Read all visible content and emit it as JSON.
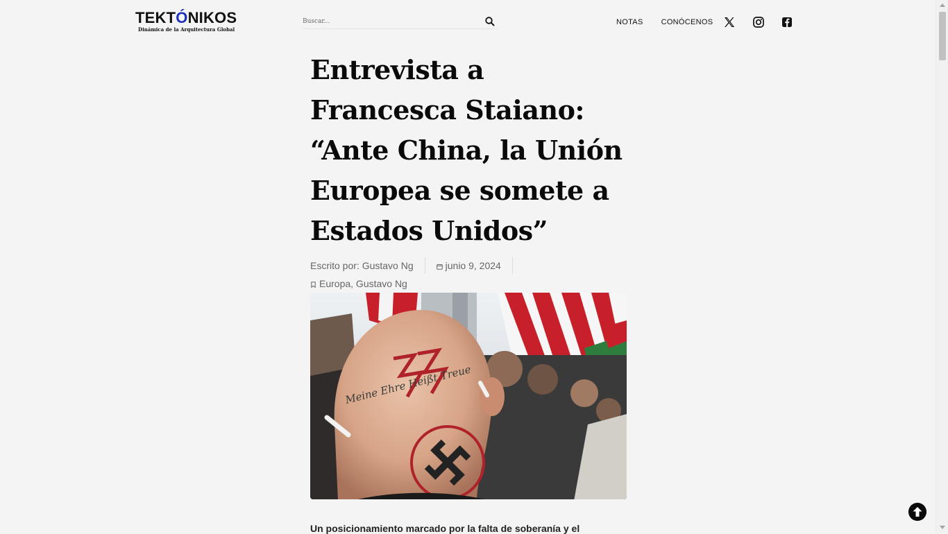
{
  "header": {
    "logo_text_a": "TEKT",
    "logo_text_o": "Ó",
    "logo_text_b": "NIKOS",
    "logo_tagline": "Dinámica de la Arquitectura Global",
    "search_placeholder": "Buscar...",
    "nav": {
      "notas": "NOTAS",
      "conocenos": "CONÓCENOS"
    },
    "social_icons": [
      "x-icon",
      "instagram-icon",
      "facebook-icon"
    ]
  },
  "article": {
    "title_lines": [
      "Entrevista a",
      "Francesca Staiano:",
      "“Ante China, la Unión",
      "Europea se somete a",
      "Estados Unidos”"
    ],
    "author_prefix": "Escrito por: ",
    "author": "Gustavo Ng",
    "date": "junio 9, 2024",
    "categories": "Europa, Gustavo Ng",
    "hero_image_caption_tattoo": "Meine Ehre Heißt Treue",
    "lead": "Un posicionamiento marcado por la falta de soberanía y el"
  },
  "colors": {
    "background": "#f4f4f4",
    "logo_accent": "#1d2fbf",
    "text": "#111111",
    "meta": "#666666"
  }
}
